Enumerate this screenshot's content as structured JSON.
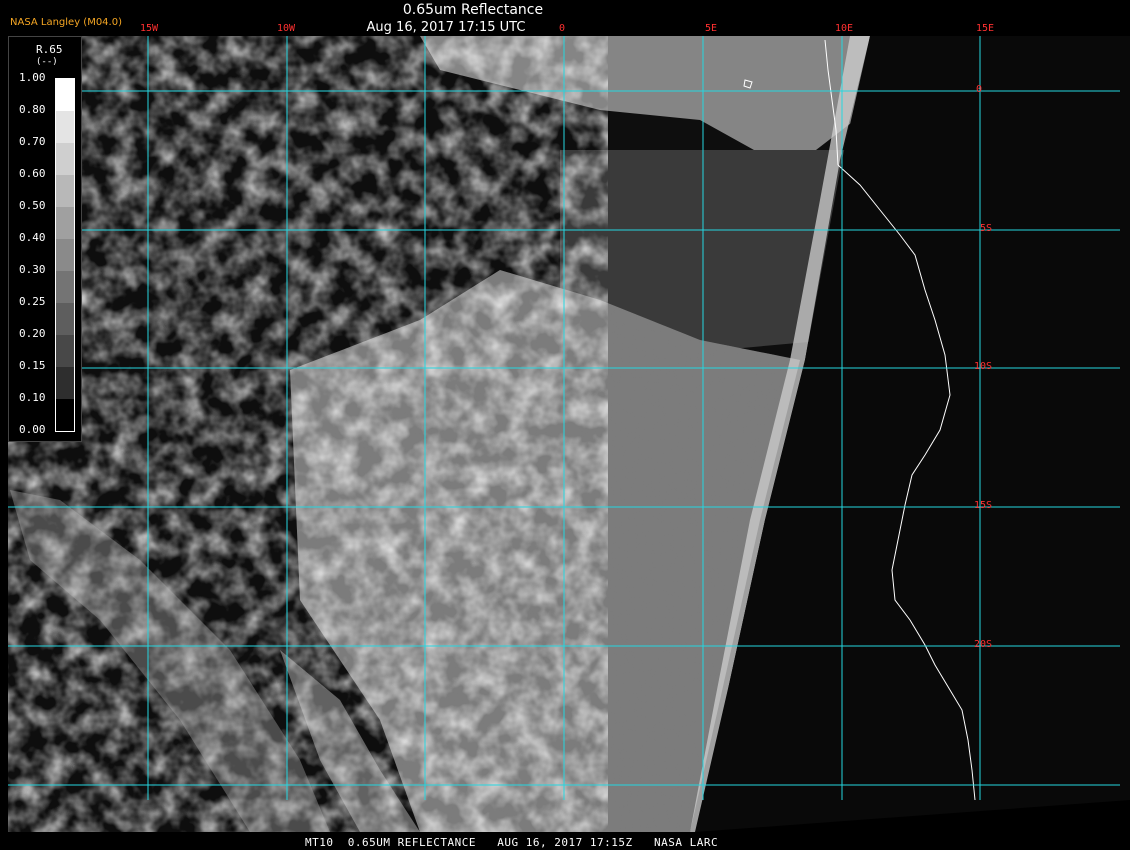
{
  "header": {
    "title": "0.65um Reflectance",
    "subtitle": "Aug 16, 2017 17:15 UTC",
    "credit": "NASA Langley (M04.0)"
  },
  "footer": {
    "text": "MT10  0.65UM REFLECTANCE   AUG 16, 2017 17:15Z   NASA LARC"
  },
  "grid": {
    "longitude_labels": [
      "15W",
      "10W",
      "0",
      "5E",
      "10E",
      "15E"
    ],
    "latitude_labels": [
      "0",
      "5S",
      "10S",
      "15S",
      "20S"
    ],
    "grid_color": "#25d6e0",
    "label_color": "#ff3030",
    "coast_color": "#ffffff"
  },
  "legend": {
    "variable": "R.65",
    "unit": "(--)",
    "ticks": [
      "1.00",
      "0.80",
      "0.70",
      "0.60",
      "0.50",
      "0.40",
      "0.30",
      "0.25",
      "0.20",
      "0.15",
      "0.10",
      "0.00"
    ]
  }
}
